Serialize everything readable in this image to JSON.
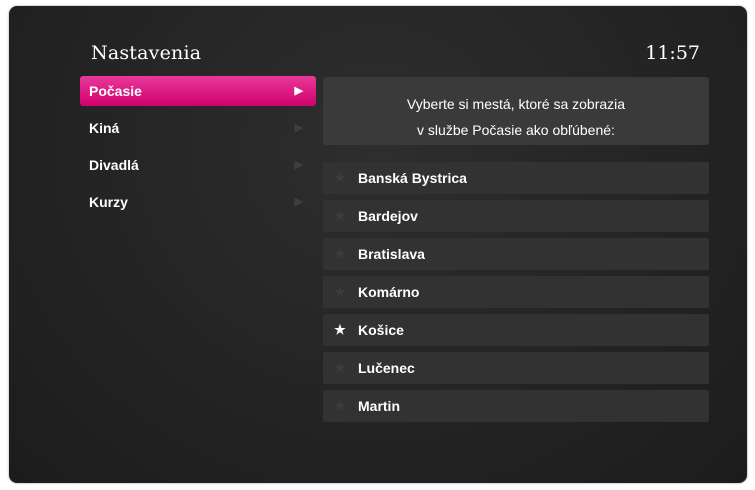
{
  "header": {
    "title": "Nastavenia",
    "clock": "11:57"
  },
  "menu": {
    "items": [
      {
        "label": "Počasie",
        "active": true
      },
      {
        "label": "Kiná",
        "active": false
      },
      {
        "label": "Divadlá",
        "active": false
      },
      {
        "label": "Kurzy",
        "active": false
      }
    ]
  },
  "info": {
    "line1": "Vyberte si mestá, ktoré sa zobrazia",
    "line2": "v službe Počasie ako obľúbené:"
  },
  "cities": [
    {
      "name": "Banská Bystrica",
      "favorite": false
    },
    {
      "name": "Bardejov",
      "favorite": false
    },
    {
      "name": "Bratislava",
      "favorite": false
    },
    {
      "name": "Komárno",
      "favorite": false
    },
    {
      "name": "Košice",
      "favorite": true
    },
    {
      "name": "Lučenec",
      "favorite": false
    },
    {
      "name": "Martin",
      "favorite": false
    }
  ],
  "colors": {
    "accent": "#d1006f",
    "background": "#262626",
    "panel": "#323232"
  },
  "icons": {
    "arrow": "arrow-right-icon",
    "star": "star-icon"
  }
}
